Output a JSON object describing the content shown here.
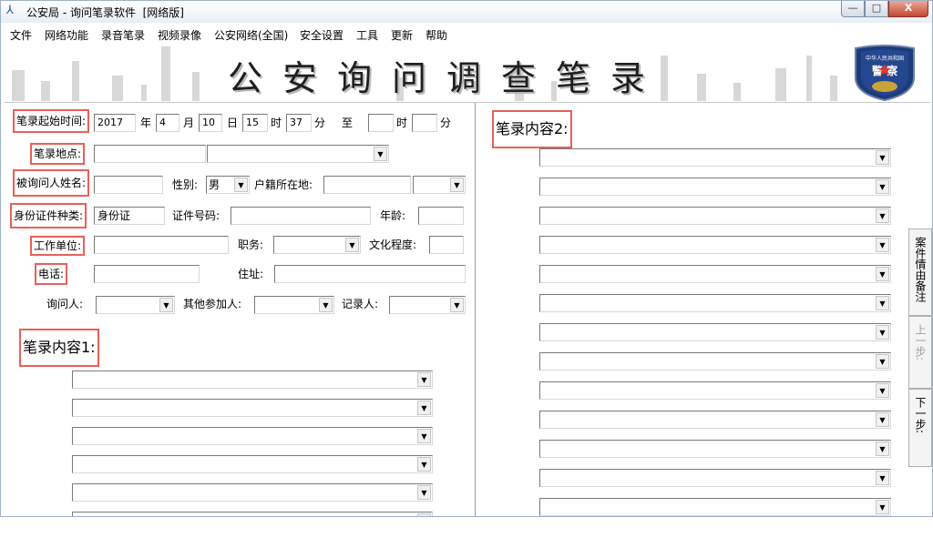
{
  "window": {
    "title": "公安局 - 询问笔录软件  [网络版]",
    "app_icon": "app-logo-icon",
    "controls": {
      "minimize": "—",
      "maximize": "□",
      "close": "X"
    }
  },
  "menu": [
    "文件",
    "网络功能",
    "录音笔录",
    "视频录像",
    "公安网络(全国)",
    "安全设置",
    "工具",
    "更新",
    "帮助"
  ],
  "banner": {
    "title": "公安询问调查笔录",
    "emblem": {
      "top_text": "中华人民共和国",
      "main_text": "警  察"
    }
  },
  "form": {
    "start_time": {
      "label": "笔录起始时间:",
      "year": "2017",
      "year_unit": "年",
      "month": "4",
      "month_unit": "月",
      "day": "10",
      "day_unit": "日",
      "hour": "15",
      "hour_unit": "时",
      "minute": "37",
      "minute_unit": "分",
      "to": "至",
      "end_hour": "",
      "end_hour_unit": "时",
      "end_minute": "",
      "end_minute_unit": "分"
    },
    "location": {
      "label": "笔录地点:",
      "value": "",
      "select": ""
    },
    "name": {
      "label": "被询问人姓名:",
      "value": ""
    },
    "gender": {
      "label": "性别:",
      "value": "男"
    },
    "household": {
      "label": "户籍所在地:",
      "value": "",
      "select": ""
    },
    "id_type": {
      "label": "身份证件种类:",
      "value": "身份证"
    },
    "id_number": {
      "label": "证件号码:",
      "value": ""
    },
    "age": {
      "label": "年龄:",
      "value": ""
    },
    "workplace": {
      "label": "工作单位:",
      "value": ""
    },
    "position": {
      "label": "职务:",
      "value": ""
    },
    "education": {
      "label": "文化程度:",
      "value": ""
    },
    "phone": {
      "label": "电话:",
      "value": ""
    },
    "address": {
      "label": "住址:",
      "value": ""
    },
    "interrogator": {
      "label": "询问人:",
      "value": ""
    },
    "others": {
      "label": "其他参加人:",
      "value": ""
    },
    "recorder": {
      "label": "记录人:",
      "value": ""
    }
  },
  "content1": {
    "label": "笔录内容1:"
  },
  "content2": {
    "label": "笔录内容2:"
  },
  "side_tabs": {
    "case_notes": "案件情由备注",
    "prev": "上一步:",
    "next": "下一步:"
  }
}
